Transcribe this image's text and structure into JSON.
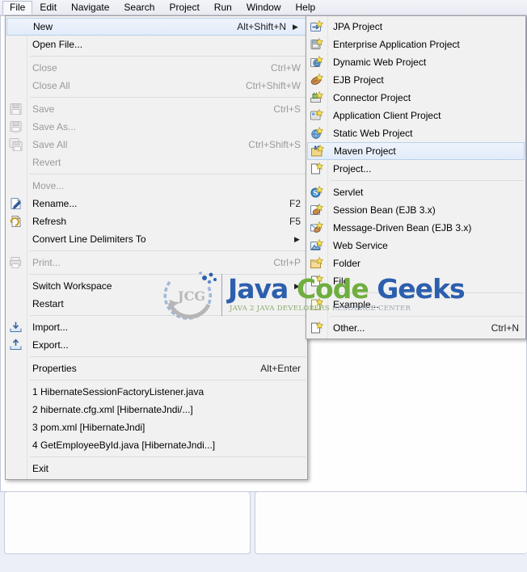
{
  "window": {
    "app": "Eclipse IDE",
    "background_color": "#e8ecf7"
  },
  "menubar": {
    "items": [
      {
        "label": "File",
        "mnemonic": "F",
        "active": true
      },
      {
        "label": "Edit",
        "mnemonic": "E",
        "active": false
      },
      {
        "label": "Navigate",
        "mnemonic": "N",
        "active": false
      },
      {
        "label": "Search",
        "mnemonic": "a",
        "active": false
      },
      {
        "label": "Project",
        "mnemonic": "P",
        "active": false
      },
      {
        "label": "Run",
        "mnemonic": "R",
        "active": false
      },
      {
        "label": "Window",
        "mnemonic": "W",
        "active": false
      },
      {
        "label": "Help",
        "mnemonic": "H",
        "active": false
      }
    ]
  },
  "file_menu": {
    "items": [
      {
        "type": "item",
        "label": "New",
        "accel": "Alt+Shift+N",
        "submenu": true,
        "highlight": true,
        "disabled": false,
        "icon": ""
      },
      {
        "type": "item",
        "label": "Open File...",
        "accel": "",
        "submenu": false,
        "highlight": false,
        "disabled": false,
        "icon": ""
      },
      {
        "type": "sep"
      },
      {
        "type": "item",
        "label": "Close",
        "accel": "Ctrl+W",
        "submenu": false,
        "highlight": false,
        "disabled": true,
        "icon": ""
      },
      {
        "type": "item",
        "label": "Close All",
        "accel": "Ctrl+Shift+W",
        "submenu": false,
        "highlight": false,
        "disabled": true,
        "icon": ""
      },
      {
        "type": "sep"
      },
      {
        "type": "item",
        "label": "Save",
        "accel": "Ctrl+S",
        "submenu": false,
        "highlight": false,
        "disabled": true,
        "icon": "save-icon"
      },
      {
        "type": "item",
        "label": "Save As...",
        "accel": "",
        "submenu": false,
        "highlight": false,
        "disabled": true,
        "icon": "save-as-icon"
      },
      {
        "type": "item",
        "label": "Save All",
        "accel": "Ctrl+Shift+S",
        "submenu": false,
        "highlight": false,
        "disabled": true,
        "icon": "save-all-icon"
      },
      {
        "type": "item",
        "label": "Revert",
        "accel": "",
        "submenu": false,
        "highlight": false,
        "disabled": true,
        "icon": ""
      },
      {
        "type": "sep"
      },
      {
        "type": "item",
        "label": "Move...",
        "accel": "",
        "submenu": false,
        "highlight": false,
        "disabled": true,
        "icon": ""
      },
      {
        "type": "item",
        "label": "Rename...",
        "accel": "F2",
        "submenu": false,
        "highlight": false,
        "disabled": false,
        "icon": "rename-icon"
      },
      {
        "type": "item",
        "label": "Refresh",
        "accel": "F5",
        "submenu": false,
        "highlight": false,
        "disabled": false,
        "icon": "refresh-icon"
      },
      {
        "type": "item",
        "label": "Convert Line Delimiters To",
        "accel": "",
        "submenu": true,
        "highlight": false,
        "disabled": false,
        "icon": ""
      },
      {
        "type": "sep"
      },
      {
        "type": "item",
        "label": "Print...",
        "accel": "Ctrl+P",
        "submenu": false,
        "highlight": false,
        "disabled": true,
        "icon": "print-icon"
      },
      {
        "type": "sep"
      },
      {
        "type": "item",
        "label": "Switch Workspace",
        "accel": "",
        "submenu": true,
        "highlight": false,
        "disabled": false,
        "icon": ""
      },
      {
        "type": "item",
        "label": "Restart",
        "accel": "",
        "submenu": false,
        "highlight": false,
        "disabled": false,
        "icon": ""
      },
      {
        "type": "sep"
      },
      {
        "type": "item",
        "label": "Import...",
        "accel": "",
        "submenu": false,
        "highlight": false,
        "disabled": false,
        "icon": "import-icon"
      },
      {
        "type": "item",
        "label": "Export...",
        "accel": "",
        "submenu": false,
        "highlight": false,
        "disabled": false,
        "icon": "export-icon"
      },
      {
        "type": "sep"
      },
      {
        "type": "item",
        "label": "Properties",
        "accel": "Alt+Enter",
        "submenu": false,
        "highlight": false,
        "disabled": false,
        "icon": ""
      },
      {
        "type": "sep"
      },
      {
        "type": "item",
        "label": "1 HibernateSessionFactoryListener.java",
        "accel": "",
        "submenu": false,
        "highlight": false,
        "disabled": false,
        "icon": ""
      },
      {
        "type": "item",
        "label": "2 hibernate.cfg.xml  [HibernateJndi/...]",
        "accel": "",
        "submenu": false,
        "highlight": false,
        "disabled": false,
        "icon": ""
      },
      {
        "type": "item",
        "label": "3 pom.xml  [HibernateJndi]",
        "accel": "",
        "submenu": false,
        "highlight": false,
        "disabled": false,
        "icon": ""
      },
      {
        "type": "item",
        "label": "4 GetEmployeeById.java  [HibernateJndi...]",
        "accel": "",
        "submenu": false,
        "highlight": false,
        "disabled": false,
        "icon": ""
      },
      {
        "type": "sep"
      },
      {
        "type": "item",
        "label": "Exit",
        "accel": "",
        "submenu": false,
        "highlight": false,
        "disabled": false,
        "icon": ""
      }
    ]
  },
  "new_submenu": {
    "items": [
      {
        "type": "item",
        "label": "JPA Project",
        "accel": "",
        "highlight": false,
        "icon": "jpa-project-icon"
      },
      {
        "type": "item",
        "label": "Enterprise Application Project",
        "accel": "",
        "highlight": false,
        "icon": "enterprise-application-project-icon"
      },
      {
        "type": "item",
        "label": "Dynamic Web Project",
        "accel": "",
        "highlight": false,
        "icon": "dynamic-web-project-icon"
      },
      {
        "type": "item",
        "label": "EJB Project",
        "accel": "",
        "highlight": false,
        "icon": "ejb-project-icon"
      },
      {
        "type": "item",
        "label": "Connector Project",
        "accel": "",
        "highlight": false,
        "icon": "connector-project-icon"
      },
      {
        "type": "item",
        "label": "Application Client Project",
        "accel": "",
        "highlight": false,
        "icon": "application-client-project-icon"
      },
      {
        "type": "item",
        "label": "Static Web Project",
        "accel": "",
        "highlight": false,
        "icon": "static-web-project-icon"
      },
      {
        "type": "item",
        "label": "Maven Project",
        "accel": "",
        "highlight": true,
        "icon": "maven-project-icon"
      },
      {
        "type": "item",
        "label": "Project...",
        "accel": "",
        "highlight": false,
        "icon": "project-icon"
      },
      {
        "type": "sep"
      },
      {
        "type": "item",
        "label": "Servlet",
        "accel": "",
        "highlight": false,
        "icon": "servlet-icon"
      },
      {
        "type": "item",
        "label": "Session Bean (EJB 3.x)",
        "accel": "",
        "highlight": false,
        "icon": "session-bean-icon"
      },
      {
        "type": "item",
        "label": "Message-Driven Bean (EJB 3.x)",
        "accel": "",
        "highlight": false,
        "icon": "message-driven-bean-icon"
      },
      {
        "type": "item",
        "label": "Web Service",
        "accel": "",
        "highlight": false,
        "icon": "web-service-icon"
      },
      {
        "type": "item",
        "label": "Folder",
        "accel": "",
        "highlight": false,
        "icon": "folder-icon"
      },
      {
        "type": "item",
        "label": "File",
        "accel": "",
        "highlight": false,
        "icon": "file-icon"
      },
      {
        "type": "sep"
      },
      {
        "type": "item",
        "label": "Example...",
        "accel": "",
        "highlight": false,
        "icon": "example-icon"
      },
      {
        "type": "sep"
      },
      {
        "type": "item",
        "label": "Other...",
        "accel": "Ctrl+N",
        "highlight": false,
        "icon": "other-icon"
      }
    ]
  },
  "watermark": {
    "logo_text": "JCG",
    "title_part1": "Java ",
    "title_part2": "Code ",
    "title_part3": "Geeks",
    "tagline_a": "JAVA 2 JAVA DEVELOPERS ",
    "tagline_b": "RESOURCE CENTER"
  }
}
